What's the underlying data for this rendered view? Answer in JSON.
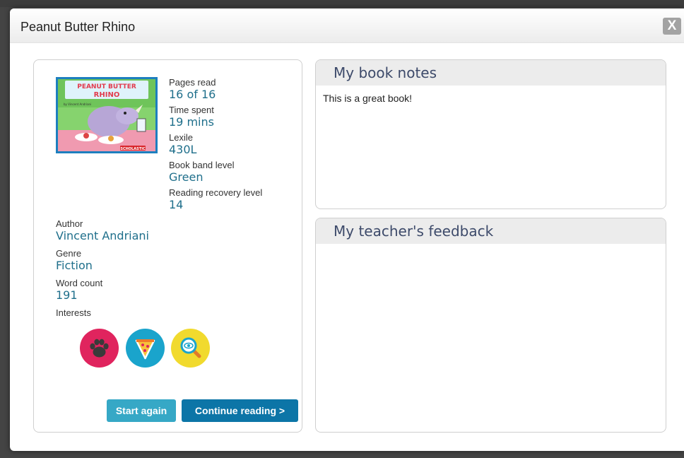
{
  "modal": {
    "title": "Peanut Butter Rhino",
    "close_label": "X"
  },
  "book": {
    "cover": {
      "title_line1": "PEANUT BUTTER",
      "title_line2": "RHINO",
      "byline": "by Vincent Andriani",
      "publisher": "SCHOLASTIC"
    },
    "stats": [
      {
        "label": "Pages read",
        "value": "16 of 16"
      },
      {
        "label": "Time spent",
        "value": "19 mins"
      },
      {
        "label": "Lexile",
        "value": "430L"
      },
      {
        "label": "Book band level",
        "value": "Green"
      },
      {
        "label": "Reading recovery level",
        "value": "14"
      }
    ],
    "details": [
      {
        "label": "Author",
        "value": "Vincent Andriani"
      },
      {
        "label": "Genre",
        "value": "Fiction"
      },
      {
        "label": "Word count",
        "value": "191"
      }
    ],
    "interests_label": "Interests",
    "interests": [
      {
        "icon": "paw-icon",
        "color": "#e0245e"
      },
      {
        "icon": "pizza-icon",
        "color": "#1aa4cc"
      },
      {
        "icon": "magnifier-eye-icon",
        "color": "#f1da2e"
      }
    ]
  },
  "actions": {
    "start_label": "Start again",
    "continue_label": "Continue reading >"
  },
  "notes": {
    "heading": "My book notes",
    "text": "This is a great book!"
  },
  "feedback": {
    "heading": "My teacher's feedback",
    "text": ""
  },
  "colors": {
    "link_value": "#1f6f8b",
    "start_button": "#36a8c6",
    "continue_button": "#0c75a7",
    "panel_heading": "#3d4a6a"
  }
}
